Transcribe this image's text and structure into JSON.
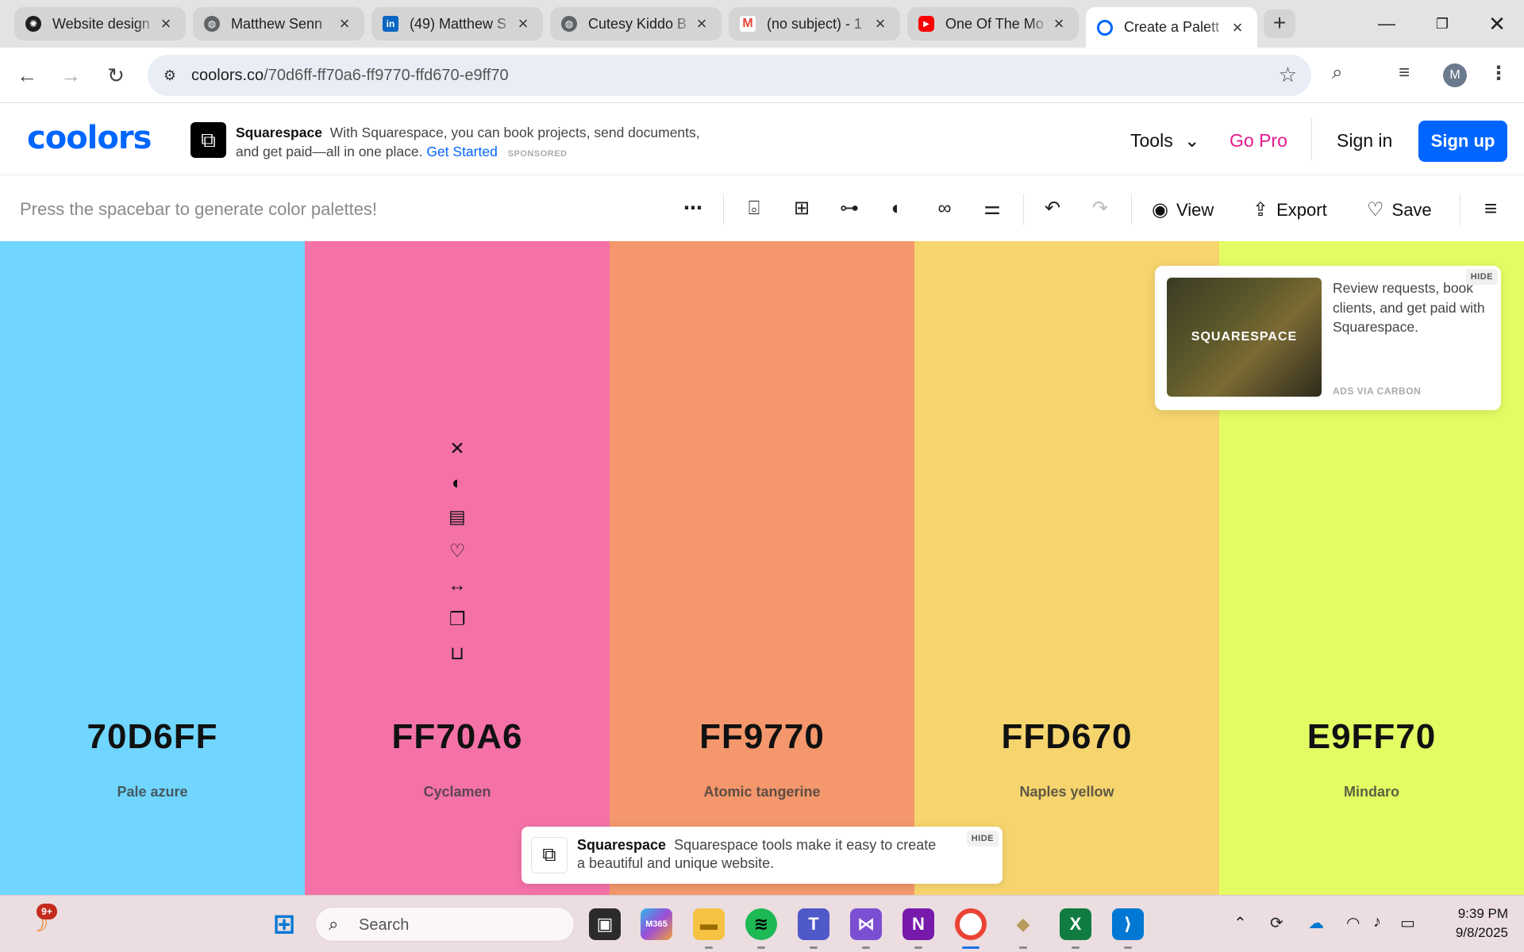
{
  "browser": {
    "tabs": [
      {
        "title": "Website design",
        "favicon": "openai-icon",
        "color": "#1f1f1f"
      },
      {
        "title": "Matthew Senn",
        "favicon": "globe-icon",
        "color": "#5f6368"
      },
      {
        "title": "(49) Matthew S",
        "favicon": "linkedin-icon",
        "color": "#0a66c2"
      },
      {
        "title": "Cutesy Kiddo B",
        "favicon": "globe-icon",
        "color": "#5f6368"
      },
      {
        "title": "(no subject) - 1",
        "favicon": "gmail-icon",
        "color": "#ea4335"
      },
      {
        "title": "One Of The Mo",
        "favicon": "youtube-icon",
        "color": "#ff0000"
      },
      {
        "title": "Create a Palett",
        "favicon": "coolors-icon",
        "color": "#0066ff"
      }
    ],
    "url_domain": "coolors.co",
    "url_path": "/70d6ff-ff70a6-ff9770-ffd670-e9ff70",
    "profile_initial": "M"
  },
  "header": {
    "logo": "coolors",
    "ad": {
      "brand": "Squarespace",
      "text": "With Squarespace, you can book projects, send documents, and get paid—all in one place.",
      "cta": "Get Started",
      "sponsored": "SPONSORED"
    },
    "tools": "Tools",
    "go_pro": "Go Pro",
    "sign_in": "Sign in",
    "sign_up": "Sign up"
  },
  "actionbar": {
    "hint": "Press the spacebar to generate color palettes!",
    "view": "View",
    "export": "Export",
    "save": "Save"
  },
  "palette": [
    {
      "hex": "70D6FF",
      "name": "Pale azure",
      "color": "#70d6ff"
    },
    {
      "hex": "FF70A6",
      "name": "Cyclamen",
      "color": "#f472a8"
    },
    {
      "hex": "FF9770",
      "name": "Atomic tangerine",
      "color": "#f4976c"
    },
    {
      "hex": "FFD670",
      "name": "Naples yellow",
      "color": "#f6d46e"
    },
    {
      "hex": "E9FF70",
      "name": "Mindaro",
      "color": "#e4fc63"
    }
  ],
  "carbon_ad": {
    "image_text": "SQUARESPACE",
    "text": "Review requests, book clients, and get paid with Squarespace.",
    "via": "ADS VIA CARBON",
    "hide": "HIDE"
  },
  "bottom_ad": {
    "brand": "Squarespace",
    "text": "Squarespace tools make it easy to create a beautiful and unique website.",
    "hide": "HIDE"
  },
  "taskbar": {
    "search_placeholder": "Search",
    "notification_badge": "9+",
    "time": "9:39 PM",
    "date": "9/8/2025"
  }
}
